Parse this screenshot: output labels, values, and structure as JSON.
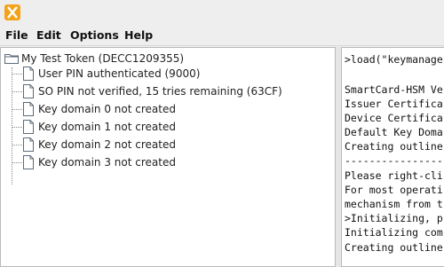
{
  "menu": {
    "file": "File",
    "edit": "Edit",
    "options": "Options",
    "help": "Help"
  },
  "tree": {
    "root_label": "My Test Token (DECC1209355)",
    "items": [
      {
        "label": "User PIN authenticated (9000)"
      },
      {
        "label": "SO PIN not verified, 15 tries remaining (63CF)"
      },
      {
        "label": "Key domain 0 not created"
      },
      {
        "label": "Key domain 1 not created"
      },
      {
        "label": "Key domain 2 not created"
      },
      {
        "label": "Key domain 3 not created"
      }
    ]
  },
  "console": {
    "lines": [
      ">load(\"keymanage",
      "",
      "SmartCard-HSM Ve",
      "Issuer Certifica",
      "Device Certifica",
      "Default Key Doma",
      "Creating outline",
      "----------------",
      "Please right-cli",
      "For most operati",
      "mechanism from t",
      ">Initializing, p",
      "Initializing com",
      "Creating outline"
    ]
  },
  "colors": {
    "app_icon": "#f3a21a",
    "panel_bg": "#ffffff",
    "window_bg": "#eeeeee"
  },
  "icons": {
    "app": "keymanager-app-icon",
    "root": "folder-icon",
    "item": "document-icon"
  }
}
